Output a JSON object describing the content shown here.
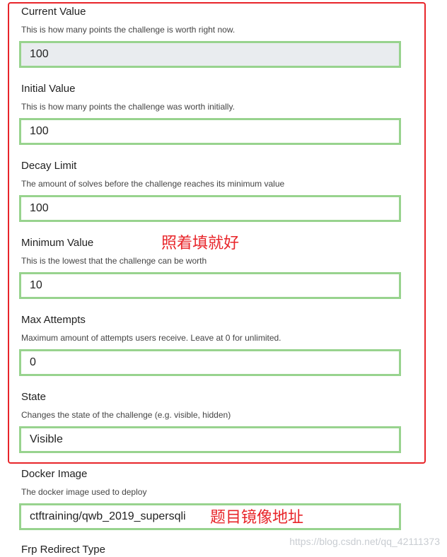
{
  "fields": [
    {
      "label": "Current Value",
      "help": "This is how many points the challenge is worth right now.",
      "value": "100"
    },
    {
      "label": "Initial Value",
      "help": "This is how many points the challenge was worth initially.",
      "value": "100"
    },
    {
      "label": "Decay Limit",
      "help": "The amount of solves before the challenge reaches its minimum value",
      "value": "100"
    },
    {
      "label": "Minimum Value",
      "help": "This is the lowest that the challenge can be worth",
      "value": "10"
    },
    {
      "label": "Max Attempts",
      "help": "Maximum amount of attempts users receive. Leave at 0 for unlimited.",
      "value": "0"
    },
    {
      "label": "State",
      "help": "Changes the state of the challenge (e.g. visible, hidden)",
      "value": "Visible"
    },
    {
      "label": "Docker Image",
      "help": "The docker image used to deploy",
      "value": "ctftraining/qwb_2019_supersqli"
    },
    {
      "label": "Frp Redirect Type"
    }
  ],
  "annotations": {
    "fill_as_shown": "照着填就好",
    "image_address": "题目镜像地址"
  },
  "watermark": "https://blog.csdn.net/qq_42111373",
  "colors": {
    "highlight_border": "#e8252a",
    "input_border": "#98d38e",
    "disabled_bg": "#e9ecef"
  }
}
